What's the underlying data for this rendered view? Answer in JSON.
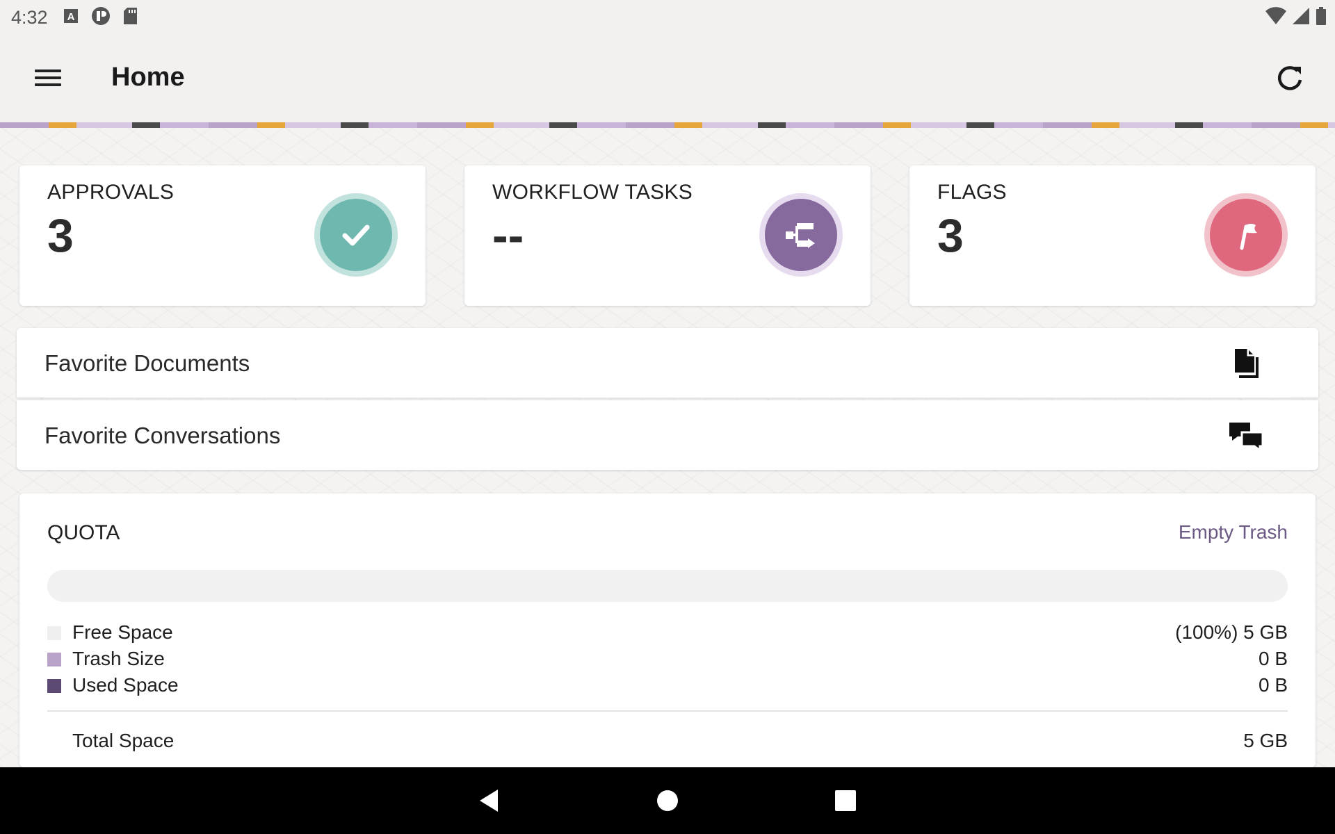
{
  "status_bar": {
    "time": "4:32"
  },
  "app_bar": {
    "title": "Home"
  },
  "stats": [
    {
      "label": "APPROVALS",
      "value": "3",
      "icon": "check-icon",
      "color": "#6fb8b0"
    },
    {
      "label": "WORKFLOW TASKS",
      "value": "--",
      "icon": "workflow-icon",
      "color": "#866a9d"
    },
    {
      "label": "FLAGS",
      "value": "3",
      "icon": "flag-icon",
      "color": "#e0687e"
    }
  ],
  "favorites": [
    {
      "label": "Favorite Documents",
      "icon": "documents-icon"
    },
    {
      "label": "Favorite Conversations",
      "icon": "conversations-icon"
    }
  ],
  "quota": {
    "title": "QUOTA",
    "empty_trash_label": "Empty Trash",
    "used_fraction": 0,
    "rows": [
      {
        "name": "Free Space",
        "value": "(100%) 5 GB",
        "color": "#efefef"
      },
      {
        "name": "Trash Size",
        "value": "0 B",
        "color": "#b9a3c9"
      },
      {
        "name": "Used Space",
        "value": "0 B",
        "color": "#5c4a74"
      }
    ],
    "total_label": "Total Space",
    "total_value": "5 GB"
  }
}
